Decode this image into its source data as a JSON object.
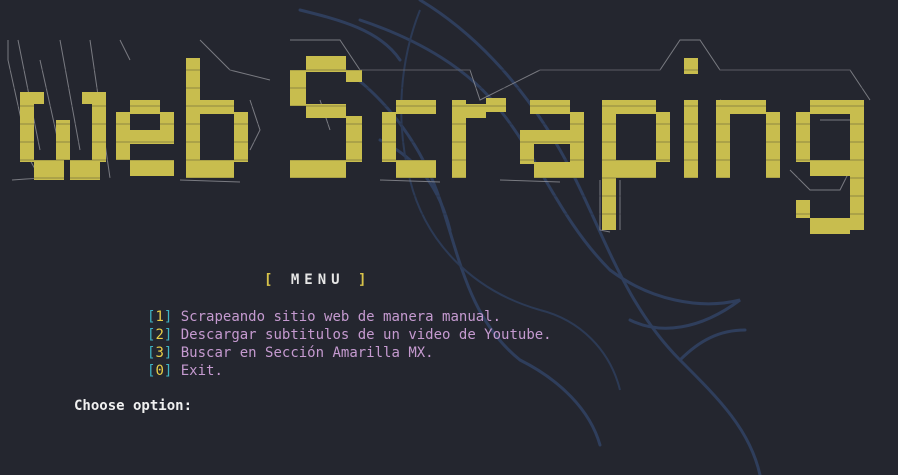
{
  "banner": {
    "text": "WebScraping",
    "color": "#c8bd4e"
  },
  "menu": {
    "bracket_open": "[",
    "title": "MENU",
    "bracket_close": "]",
    "items": [
      {
        "key": "1",
        "label": "Scrapeando sitio web de manera manual."
      },
      {
        "key": "2",
        "label": "Descargar subtitulos de un video de Youtube."
      },
      {
        "key": "3",
        "label": "Buscar en Sección Amarilla MX."
      },
      {
        "key": "0",
        "label": "Exit."
      }
    ]
  },
  "prompt": {
    "text": "Choose option:"
  },
  "colors": {
    "background": "#24262f",
    "banner_yellow": "#c8bd4e",
    "bracket_cyan": "#3fb4c4",
    "number_yellow": "#e8cf47",
    "label_purple": "#c59ad0",
    "prompt_white": "#f0f0f0",
    "watermark_blue": "#2f3e5c"
  },
  "background_icon": "kali-dragon-icon"
}
